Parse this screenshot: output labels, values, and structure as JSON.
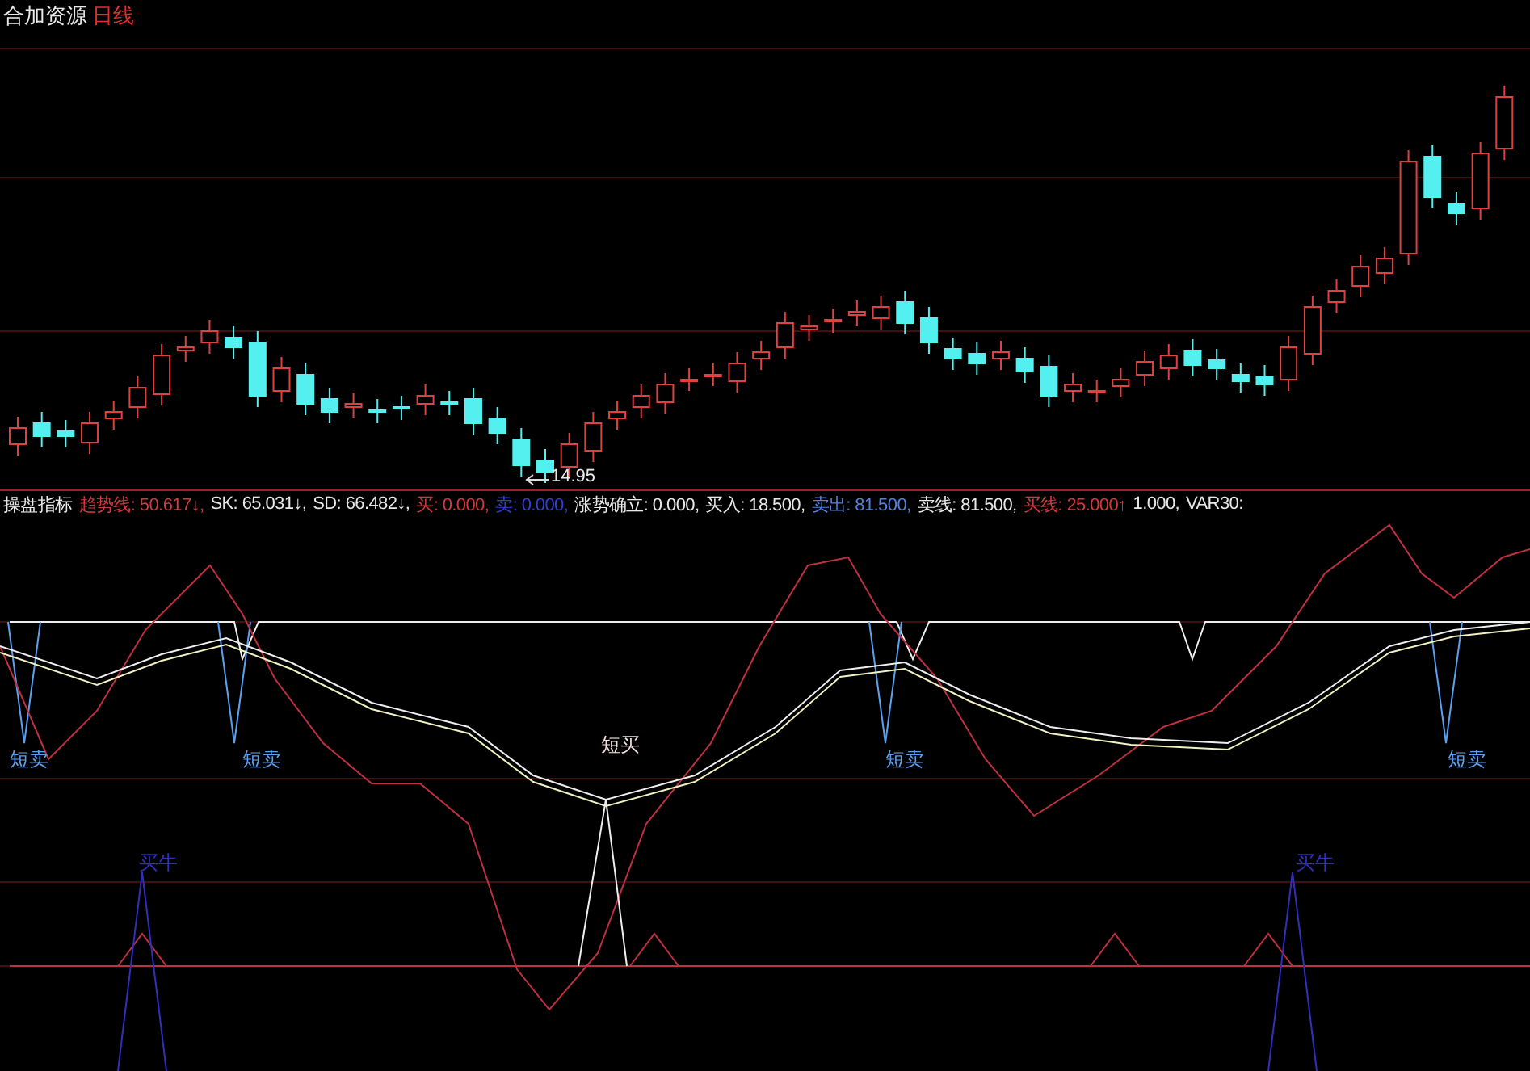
{
  "title_bar": {
    "stock": "合加资源",
    "period": "日线"
  },
  "price_chart": {
    "low_label": "14.95"
  },
  "indicator_bar": {
    "name": "操盘指标",
    "values": [
      {
        "text": "趋势线: 50.617↓,",
        "color": "#d23a3a"
      },
      {
        "text": "SK: 65.031↓,",
        "color": "#e8e8e8"
      },
      {
        "text": "SD: 66.482↓,",
        "color": "#e8e8e8"
      },
      {
        "text": "买: 0.000,",
        "color": "#d23a3a"
      },
      {
        "text": "卖: 0.000,",
        "color": "#3040d0"
      },
      {
        "text": "涨势确立: 0.000,",
        "color": "#e8e8e8"
      },
      {
        "text": "买入: 18.500,",
        "color": "#e8e8e8"
      },
      {
        "text": "卖出: 81.500,",
        "color": "#5080e0"
      },
      {
        "text": "卖线: 81.500,",
        "color": "#e8e8e8"
      },
      {
        "text": "买线: 25.000↑",
        "color": "#d23a3a"
      },
      {
        "text": "1.000,",
        "color": "#e8e8e8"
      },
      {
        "text": "VAR30:",
        "color": "#e8e8e8"
      }
    ]
  },
  "signals": [
    {
      "kind": "sell",
      "text": "短卖"
    },
    {
      "kind": "sell",
      "text": "短卖"
    },
    {
      "kind": "buy",
      "text": "短买"
    },
    {
      "kind": "sell",
      "text": "短卖"
    },
    {
      "kind": "sell",
      "text": "短卖"
    },
    {
      "kind": "bull",
      "text": "买牛"
    },
    {
      "kind": "bull",
      "text": "买牛"
    }
  ]
}
